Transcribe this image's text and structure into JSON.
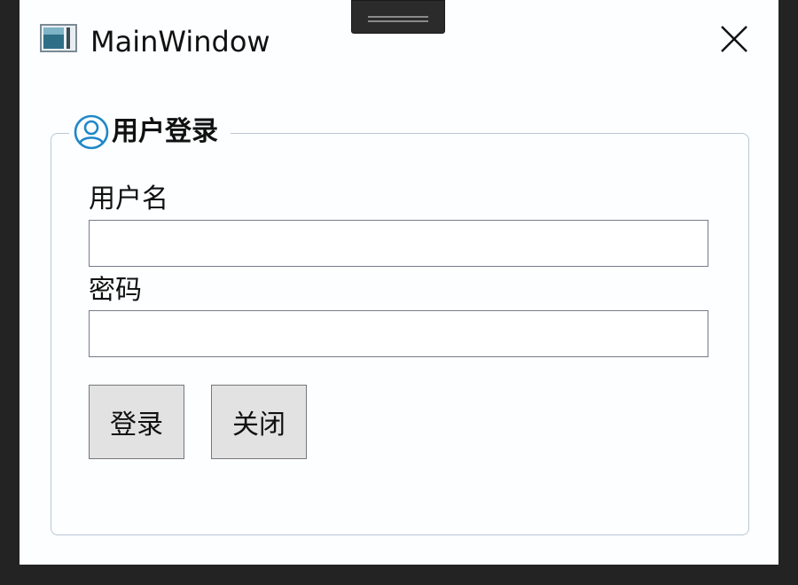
{
  "window": {
    "title": "MainWindow",
    "icons": {
      "app": "window-app-icon",
      "close": "close-icon"
    }
  },
  "login_group": {
    "header": "用户登录",
    "header_icon": "user-circle-icon",
    "username_label": "用户名",
    "username_value": "",
    "password_label": "密码",
    "password_value": "",
    "login_button": "登录",
    "close_button": "关闭"
  },
  "colors": {
    "window_bg": "#fdfeff",
    "outer_bg": "#232323",
    "accent": "#1e88c8",
    "button_bg": "#e2e2e2"
  }
}
